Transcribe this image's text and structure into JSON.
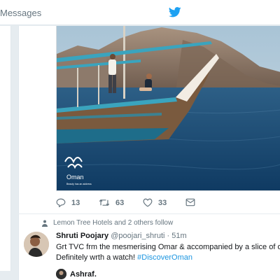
{
  "topbar": {
    "messages_label": "Messages",
    "twitter_logo_icon": "twitter-bird-icon"
  },
  "media": {
    "watermark_line1": "Oman",
    "watermark_line2": "Beauty has an address"
  },
  "actions": {
    "reply_count": "13",
    "retweet_count": "63",
    "like_count": "33"
  },
  "social_context": {
    "text": "Lemon Tree Hotels and 2 others follow"
  },
  "tweet": {
    "name": "Shruti Poojary",
    "handle": "@poojari_shruti",
    "separator": "·",
    "time": "51m",
    "line1": "Grt TVC frm the mesmerising Omar & accompanied by a slice of ou",
    "line2_prefix": "Definitely wrth a watch! ",
    "hashtag": "#DiscoverOman"
  },
  "next_tweet": {
    "name": "Ashraf."
  },
  "colors": {
    "twitter_blue": "#1da1f2",
    "link_blue": "#1b95e0",
    "muted": "#66757f"
  }
}
